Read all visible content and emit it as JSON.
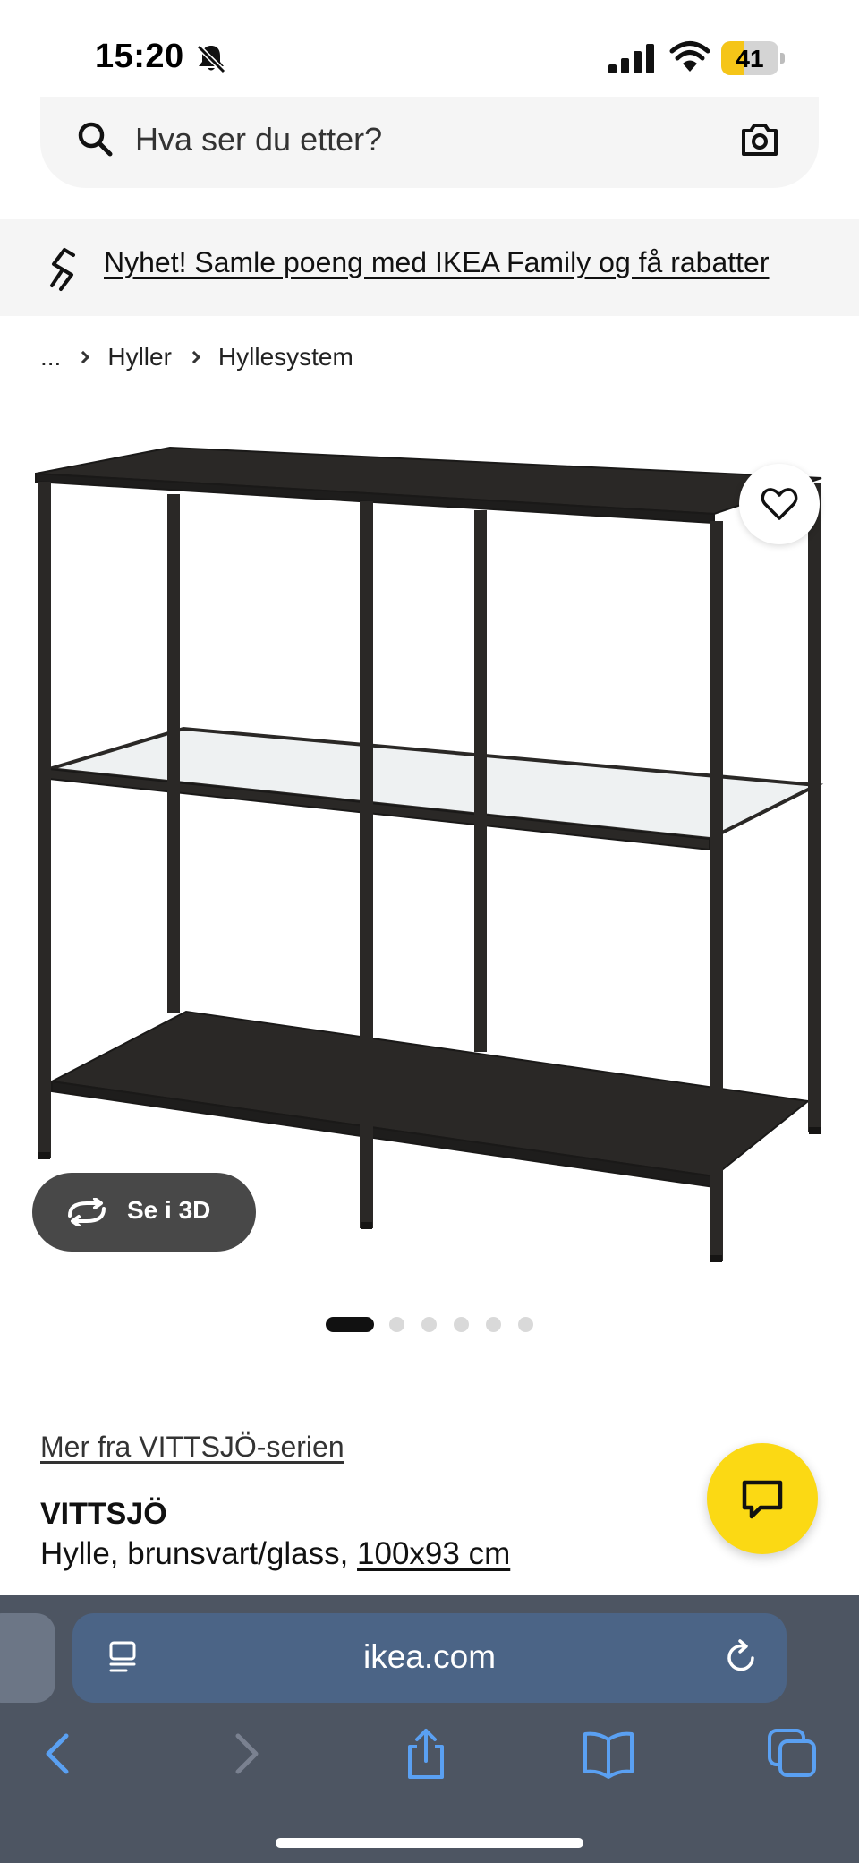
{
  "status_bar": {
    "time": "15:20",
    "battery_level": 41,
    "battery_text": "41",
    "battery_color": "#f5c518",
    "icons": [
      "bell-slash-icon",
      "cellular-signal-icon",
      "wifi-icon",
      "battery-icon"
    ]
  },
  "search": {
    "placeholder": "Hva ser du etter?",
    "icons": [
      "search-icon",
      "camera-icon"
    ]
  },
  "promo": {
    "text": "Nyhet! Samle poeng med IKEA Family og få rabatter",
    "icon": "ikea-family-icon",
    "background": "#f5f5f5"
  },
  "breadcrumb": {
    "items": [
      "...",
      "Hyller",
      "Hyllesystem"
    ]
  },
  "gallery": {
    "view_3d_label": "Se i 3D",
    "favorite_icon": "heart-icon",
    "rotate_icon": "rotate-3d-icon",
    "dots_total": 6,
    "active_dot": 0
  },
  "product": {
    "series_link": "Mer fra VITTSJÖ-serien",
    "name": "VITTSJÖ",
    "description": "Hylle, brunsvart/glass, ",
    "size": "100x93 cm"
  },
  "chat": {
    "icon": "chat-icon",
    "color": "#fbd914"
  },
  "browser": {
    "url": "ikea.com",
    "icons": [
      "reader-icon",
      "reload-icon",
      "back-icon",
      "forward-icon",
      "share-icon",
      "bookmarks-icon",
      "tabs-icon"
    ],
    "accent": "#5aa0f2"
  }
}
